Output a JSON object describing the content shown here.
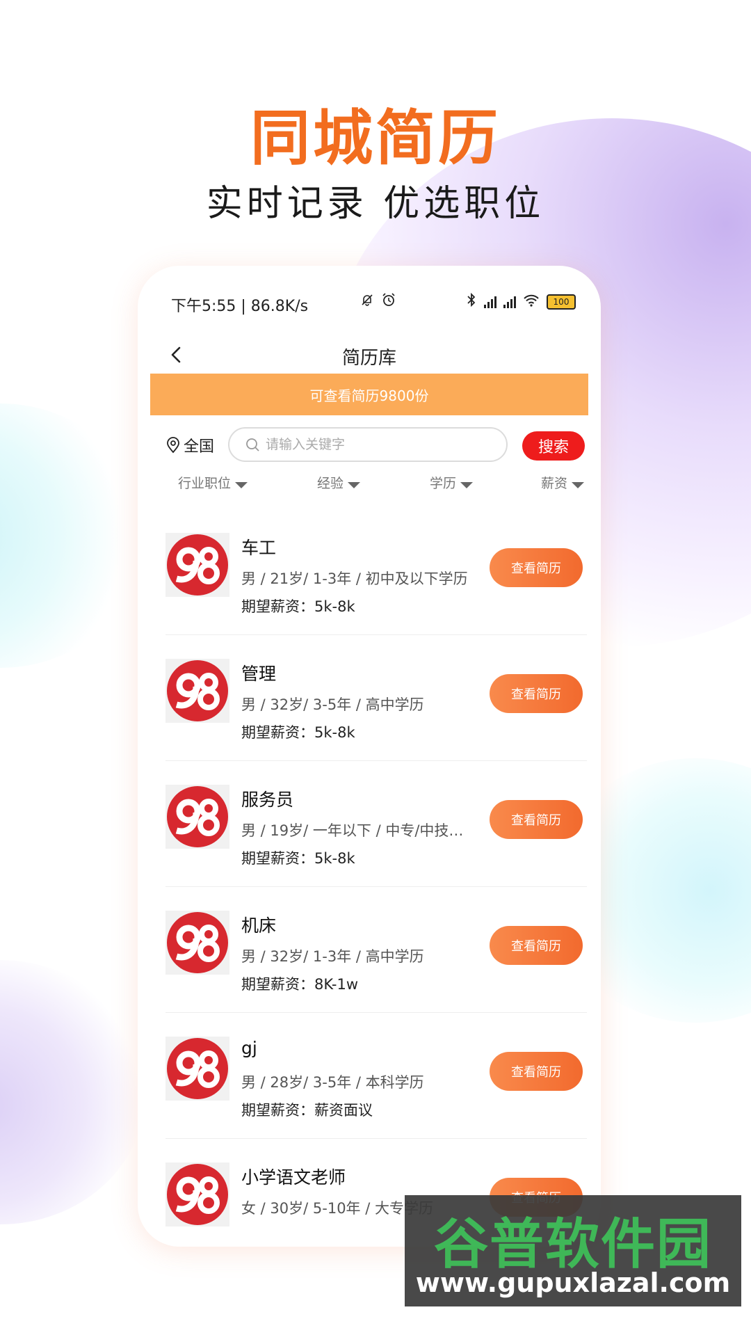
{
  "promo": {
    "headline": "同城简历",
    "subheadline": "实时记录 优选职位"
  },
  "statusbar": {
    "time": "下午5:55 | 86.8K/s",
    "battery": "100",
    "icons": [
      "mute-bell-icon",
      "alarm-icon",
      "bluetooth-icon",
      "signal-hd-icon",
      "signal-hd-icon",
      "wifi-icon",
      "battery-icon"
    ]
  },
  "nav": {
    "title": "简历库",
    "back_icon": "chevron-left-icon"
  },
  "banner": {
    "text": "可查看简历9800份"
  },
  "search": {
    "region": "全国",
    "placeholder": "请输入关键字",
    "button": "搜索"
  },
  "filters": [
    "行业职位",
    "经验",
    "学历",
    "薪资"
  ],
  "resumes": [
    {
      "title": "车工",
      "meta": "男 / 21岁/ 1-3年 / 初中及以下学历",
      "salary": "期望薪资：5k-8k",
      "button": "查看简历"
    },
    {
      "title": "管理",
      "meta": "男 / 32岁/ 3-5年 / 高中学历",
      "salary": "期望薪资：5k-8k",
      "button": "查看简历"
    },
    {
      "title": "服务员",
      "meta": "男 / 19岁/ 一年以下 / 中专/中技…",
      "salary": "期望薪资：5k-8k",
      "button": "查看简历"
    },
    {
      "title": "机床",
      "meta": "男 / 32岁/ 1-3年 / 高中学历",
      "salary": "期望薪资：8K-1w",
      "button": "查看简历"
    },
    {
      "title": "gj",
      "meta": "男 / 28岁/ 3-5年 / 本科学历",
      "salary": "期望薪资：薪资面议",
      "button": "查看简历"
    },
    {
      "title": "小学语文老师",
      "meta": "女 / 30岁/ 5-10年 / 大专学历",
      "salary": "",
      "button": "查看简历"
    }
  ],
  "watermark": {
    "logo": "谷普软件园",
    "url": "www.gupuxlazal.com"
  },
  "colors": {
    "headline": "#f26d1f",
    "banner": "#fbab58",
    "search_button": "#ee1c1c",
    "view_button": "#f57a3a",
    "avatar_logo": "#d7282f"
  }
}
